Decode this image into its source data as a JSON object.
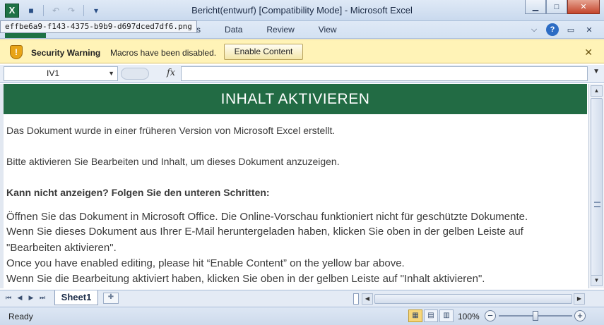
{
  "window": {
    "title": "Bericht(entwurf)  [Compatibility Mode] - Microsoft Excel",
    "app_icon_letter": "X",
    "controls": [
      "minimize",
      "maximize",
      "close"
    ]
  },
  "quick_access": {
    "items": [
      "save-icon",
      "undo-icon",
      "redo-icon",
      "customize-icon"
    ]
  },
  "tooltip": {
    "text": "effbe6a9-f143-4375-b9b9-d697dced7df6.png"
  },
  "ribbon": {
    "file_tab": "File",
    "tabs": [
      "ut",
      "Formulas",
      "Data",
      "Review",
      "View"
    ],
    "right_icons": [
      "minimize-ribbon-icon",
      "help-icon",
      "restore-window-icon",
      "close-window-icon"
    ]
  },
  "security_bar": {
    "title": "Security Warning",
    "message": "Macros have been disabled.",
    "button_label": "Enable Content",
    "close_glyph": "✕",
    "color": "#fff3b7"
  },
  "formula_bar": {
    "name_box": "IV1",
    "fx_label": "fx",
    "formula_value": ""
  },
  "sheet": {
    "banner": "INHALT AKTIVIEREN",
    "banner_color": "#226b44",
    "lines": [
      "Das Dokument wurde in einer früheren Version von Microsoft Excel erstellt.",
      "Bitte aktivieren Sie Bearbeiten und Inhalt, um dieses Dokument anzuzeigen.",
      "Kann nicht anzeigen? Folgen Sie den unteren Schritten:",
      "Öffnen Sie das Dokument in Microsoft Office. Die Online-Vorschau funktioniert nicht für geschützte Dokumente.",
      "Wenn Sie dieses Dokument aus Ihrer E-Mail heruntergeladen haben, klicken Sie oben in der gelben Leiste auf",
      "\"Bearbeiten aktivieren\".",
      "Once you have enabled editing, please hit “Enable Content” on the yellow bar above.",
      "Wenn Sie die Bearbeitung aktiviert haben, klicken Sie oben in der gelben Leiste auf \"Inhalt aktivieren\"."
    ]
  },
  "sheet_tabs": {
    "active": "Sheet1"
  },
  "status_bar": {
    "ready": "Ready",
    "zoom": "100%",
    "zoom_out": "−",
    "zoom_in": "+"
  }
}
